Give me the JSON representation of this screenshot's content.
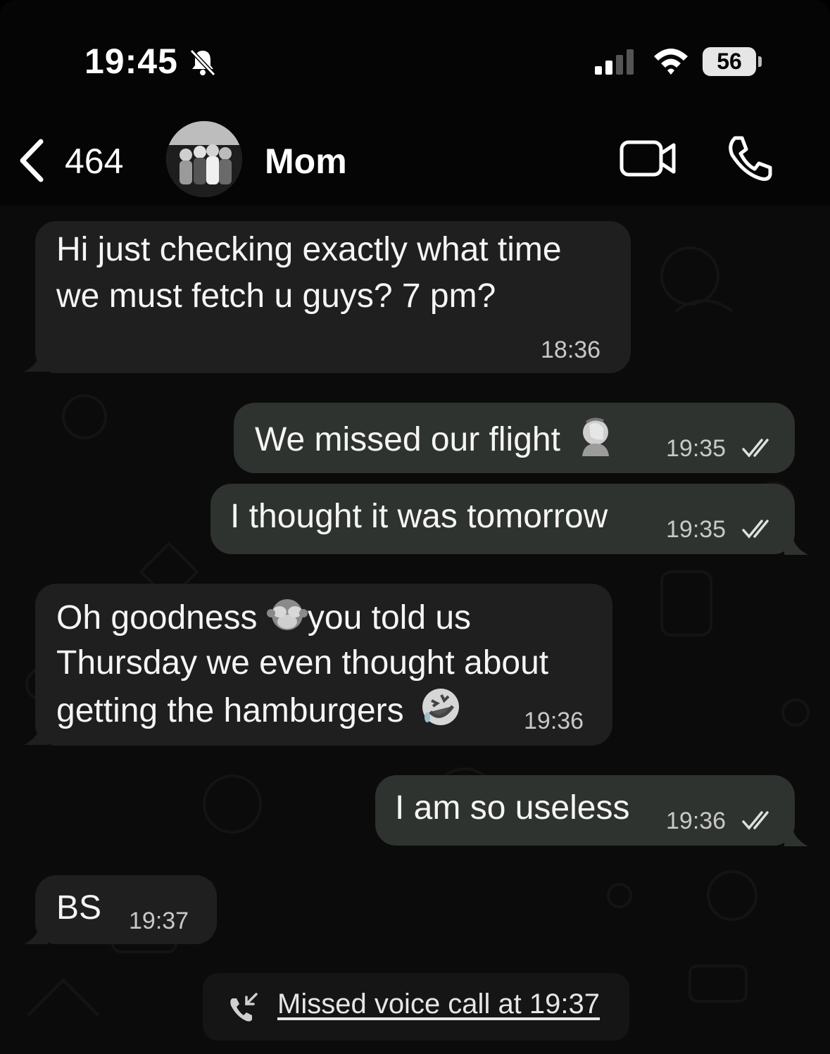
{
  "status_bar": {
    "time": "19:45",
    "battery": "56"
  },
  "header": {
    "back_count": "464",
    "contact_name": "Mom"
  },
  "messages": [
    {
      "direction": "incoming",
      "lines": [
        "Hi just checking exactly what time",
        "we must fetch u guys? 7 pm?"
      ],
      "time": "18:36"
    },
    {
      "direction": "outgoing",
      "text": "We missed our flight",
      "emoji": "face-palm",
      "time": "19:35",
      "status": "read"
    },
    {
      "direction": "outgoing",
      "text": "I thought it was tomorrow",
      "time": "19:35",
      "status": "read"
    },
    {
      "direction": "incoming",
      "line1_before": "Oh goodness",
      "emoji1": "see-no-evil-monkey",
      "line1_after": "you told us",
      "line2": "Thursday we even thought about",
      "line3": "getting the hamburgers",
      "emoji2": "rolling-on-floor-laughing",
      "time": "19:36"
    },
    {
      "direction": "outgoing",
      "text": "I am so useless",
      "time": "19:36",
      "status": "read"
    },
    {
      "direction": "incoming",
      "text": "BS",
      "time": "19:37"
    }
  ],
  "system_event": {
    "icon": "missed-call-icon",
    "text": "Missed voice call at 19:37"
  },
  "colors": {
    "incoming_bubble": "#1f1f1f",
    "outgoing_bubble": "#2e332f",
    "background": "#0b0b0b"
  }
}
